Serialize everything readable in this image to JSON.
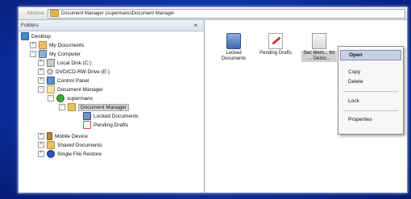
{
  "window": {
    "address_label": "Address",
    "address_path": "Document Manager (supermans\\Document Manager"
  },
  "folders": {
    "title": "Folders",
    "tree": [
      {
        "label": "Desktop",
        "icon": "desktop-icon"
      },
      {
        "label": "My Documents",
        "icon": "folder-icon"
      },
      {
        "label": "My Computer",
        "icon": "computer-icon"
      },
      {
        "label": "Local Disk (C:)",
        "icon": "disk-icon"
      },
      {
        "label": "DVD/CD-RW Drive (E:)",
        "icon": "dvd-icon"
      },
      {
        "label": "Control Panel",
        "icon": "control-panel-icon"
      },
      {
        "label": "Document Manager",
        "icon": "document-manager-icon"
      },
      {
        "label": "supermans",
        "icon": "user-icon"
      },
      {
        "label": "Document Manager",
        "icon": "folder-icon"
      },
      {
        "label": "Locked Documents",
        "icon": "locked-documents-icon"
      },
      {
        "label": "Pending Drafts",
        "icon": "pending-drafts-icon"
      },
      {
        "label": "Mobile Device",
        "icon": "mobile-device-icon"
      },
      {
        "label": "Shared Documents",
        "icon": "folder-icon"
      },
      {
        "label": "Single File Restore",
        "icon": "restore-icon"
      }
    ]
  },
  "content": {
    "items": [
      {
        "label": "Locked Documents",
        "icon": "locked-documents-icon"
      },
      {
        "label": "Pending Drafts",
        "icon": "pending-drafts-icon"
      },
      {
        "label": "Sec Mem... for ... Demo...",
        "icon": "document-icon"
      }
    ]
  },
  "context_menu": {
    "items": [
      "Open",
      "Copy",
      "Delete",
      "Lock",
      "Properties"
    ]
  }
}
